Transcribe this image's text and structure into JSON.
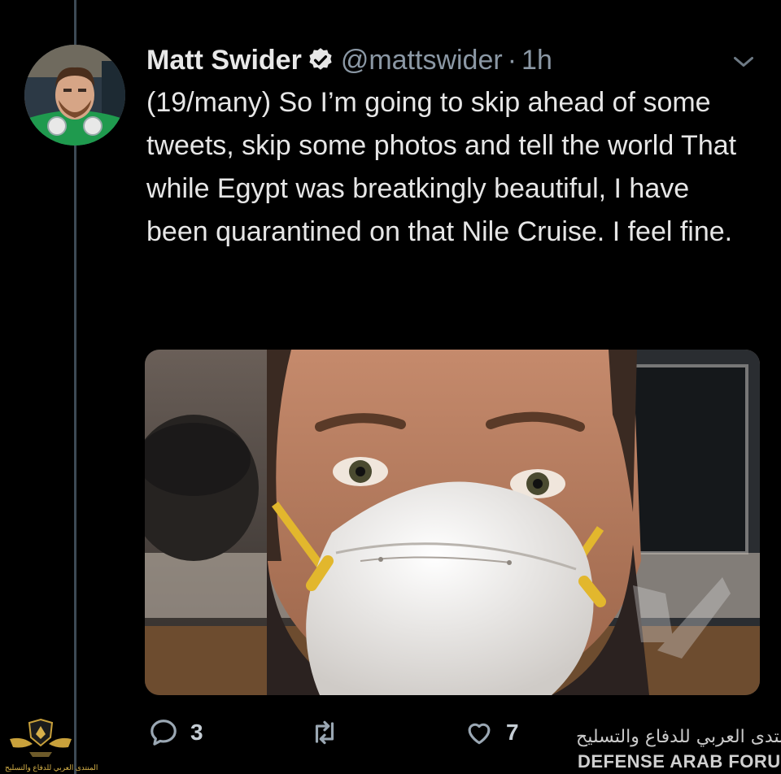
{
  "tweet": {
    "author_name": "Matt Swider",
    "handle": "@mattswider",
    "separator": "·",
    "timestamp": "1h",
    "text": "(19/many) So I’m going to skip ahead of some tweets, skip some photos and tell the world That while Egypt was breatkingly beautiful, I have been quarantined on that Nile Cruise. I feel fine."
  },
  "actions": {
    "reply_count": "3",
    "retweet_count": "",
    "like_count": "7"
  },
  "watermark": {
    "arabic": "المنتدى العربي للدفاع والتسليح",
    "english": "DEFENSE ARAB FORUM",
    "small_text": "المنتدى العربي للدفاع والتسليح"
  },
  "colors": {
    "background": "#000000",
    "text_primary": "#e6e6e6",
    "text_secondary": "#8b98a5",
    "thread_line": "#3d4a55"
  },
  "icons": {
    "verified": "verified-badge-icon",
    "caret": "chevron-down-icon",
    "reply": "reply-icon",
    "retweet": "retweet-icon",
    "like": "heart-icon",
    "share": "share-icon"
  }
}
